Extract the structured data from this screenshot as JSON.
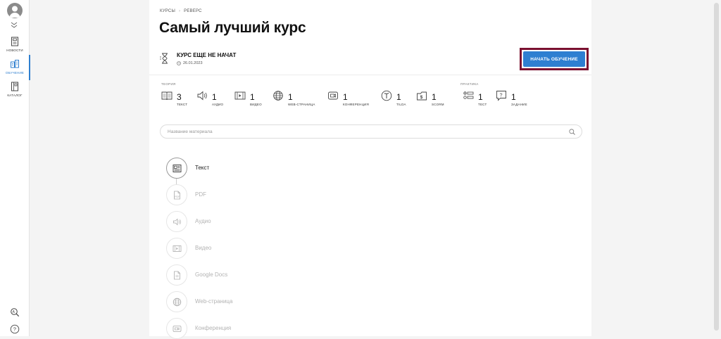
{
  "nav": {
    "items": [
      {
        "label": "НОВОСТИ",
        "icon": "news-icon"
      },
      {
        "label": "ОБУЧЕНИЕ",
        "icon": "learning-icon"
      },
      {
        "label": "КАТАЛОГ",
        "icon": "catalog-icon"
      }
    ],
    "active": "ОБУЧЕНИЕ",
    "bottom_icons": [
      "search-text-icon",
      "help-icon"
    ]
  },
  "breadcrumb": [
    "КУРСЫ",
    "РЕВЕРС"
  ],
  "page_title": "Самый лучший курс",
  "status": {
    "title": "КУРС ЕЩЕ НЕ НАЧАТ",
    "date": "26.01.2023"
  },
  "start_button": "НАЧАТЬ ОБУЧЕНИЕ",
  "theory": {
    "label": "ТЕОРИЯ",
    "stats": [
      {
        "count": "3",
        "label": "ТЕКСТ",
        "icon": "text-icon"
      },
      {
        "count": "1",
        "label": "АУДИО",
        "icon": "audio-icon"
      },
      {
        "count": "1",
        "label": "ВИДЕО",
        "icon": "video-icon"
      },
      {
        "count": "1",
        "label": "WEB-СТРАНИЦА",
        "icon": "globe-icon"
      },
      {
        "count": "1",
        "label": "КОНФЕРЕНЦИЯ",
        "icon": "conference-icon"
      },
      {
        "count": "1",
        "label": "TILDA",
        "icon": "tilda-icon"
      },
      {
        "count": "1",
        "label": "SCORM",
        "icon": "scorm-icon"
      }
    ]
  },
  "practice": {
    "label": "ПРАКТИКА",
    "stats": [
      {
        "count": "1",
        "label": "ТЕСТ",
        "icon": "test-icon"
      },
      {
        "count": "1",
        "label": "ЗАДАНИЕ",
        "icon": "task-icon"
      }
    ]
  },
  "search": {
    "placeholder": "Название материала"
  },
  "materials": [
    {
      "label": "Текст",
      "icon": "text-icon",
      "active": true
    },
    {
      "label": "PDF",
      "icon": "pdf-icon",
      "active": false
    },
    {
      "label": "Аудио",
      "icon": "audio-icon",
      "active": false
    },
    {
      "label": "Видео",
      "icon": "video-icon",
      "active": false
    },
    {
      "label": "Google Docs",
      "icon": "document-icon",
      "active": false
    },
    {
      "label": "Web-страница",
      "icon": "globe-icon",
      "active": false
    },
    {
      "label": "Конференция",
      "icon": "conference-icon",
      "active": false
    }
  ],
  "colors": {
    "accent": "#2e7fd1",
    "highlight_frame": "#7a1030"
  }
}
